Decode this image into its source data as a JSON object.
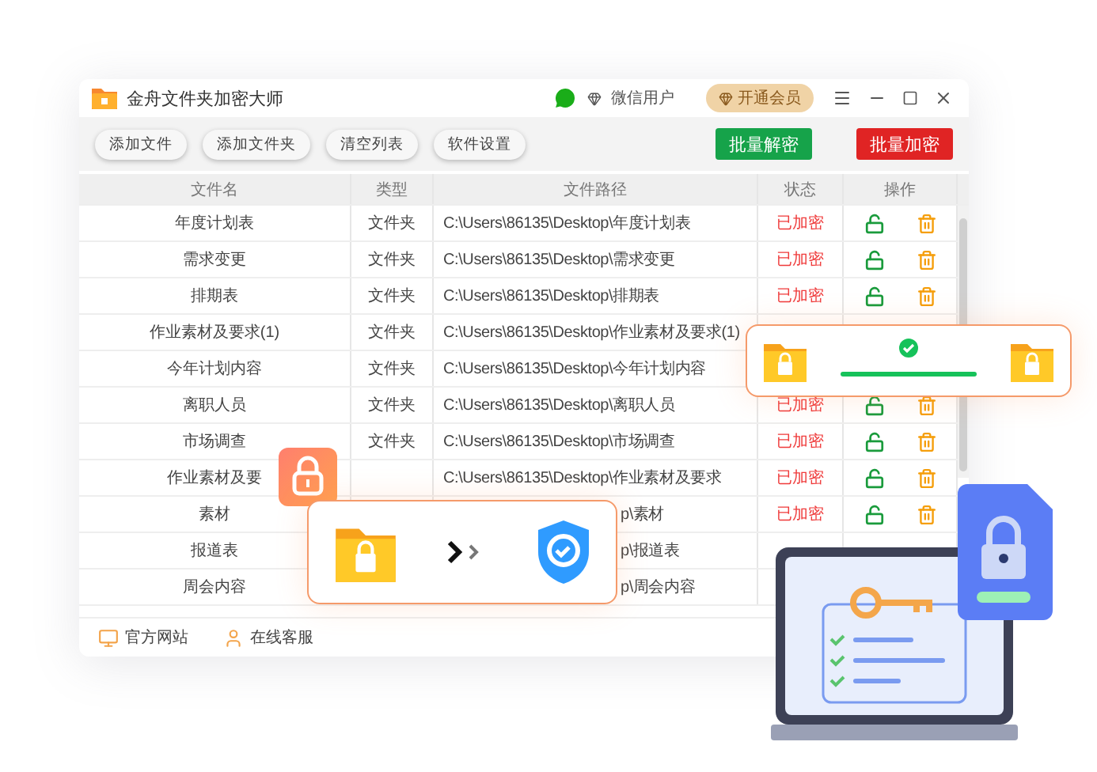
{
  "window": {
    "title": "金舟文件夹加密大师",
    "user": "微信用户",
    "vip_button": "开通会员"
  },
  "toolbar": {
    "buttons": [
      "添加文件",
      "添加文件夹",
      "清空列表",
      "软件设置"
    ],
    "decrypt_button": "批量解密",
    "encrypt_button": "批量加密"
  },
  "table": {
    "columns": [
      "文件名",
      "类型",
      "文件路径",
      "状态",
      "操作"
    ],
    "rows": [
      {
        "name": "年度计划表",
        "type": "文件夹",
        "path": "C:\\Users\\86135\\Desktop\\年度计划表",
        "path_covered": false,
        "status": "已加密",
        "actions": true
      },
      {
        "name": "需求变更",
        "type": "文件夹",
        "path": "C:\\Users\\86135\\Desktop\\需求变更",
        "path_covered": false,
        "status": "已加密",
        "actions": true
      },
      {
        "name": "排期表",
        "type": "文件夹",
        "path": "C:\\Users\\86135\\Desktop\\排期表",
        "path_covered": false,
        "status": "已加密",
        "actions": true
      },
      {
        "name": "作业素材及要求(1)",
        "type": "文件夹",
        "path": "C:\\Users\\86135\\Desktop\\作业素材及要求(1)",
        "path_covered": false
      },
      {
        "name": "今年计划内容",
        "type": "文件夹",
        "path": "C:\\Users\\86135\\Desktop\\今年计划内容",
        "path_covered": false
      },
      {
        "name": "离职人员",
        "type": "文件夹",
        "path": "C:\\Users\\86135\\Desktop\\离职人员",
        "path_covered": false,
        "status": "已加密",
        "actions": true
      },
      {
        "name": "市场调查",
        "type": "文件夹",
        "path": "C:\\Users\\86135\\Desktop\\市场调查",
        "path_covered": false,
        "status": "已加密",
        "actions": true
      },
      {
        "name": "作业素材及要",
        "path": "C:\\Users\\86135\\Desktop\\作业素材及要求",
        "path_covered": false,
        "status": "已加密",
        "actions": true
      },
      {
        "name": "素材",
        "path": "p\\素材",
        "path_covered": true,
        "status": "已加密",
        "actions": true
      },
      {
        "name": "报道表",
        "path": "p\\报道表",
        "path_covered": true
      },
      {
        "name": "周会内容",
        "path": "p\\周会内容",
        "path_covered": true
      }
    ]
  },
  "footer": {
    "links": [
      "官方网站",
      "在线客服"
    ]
  }
}
